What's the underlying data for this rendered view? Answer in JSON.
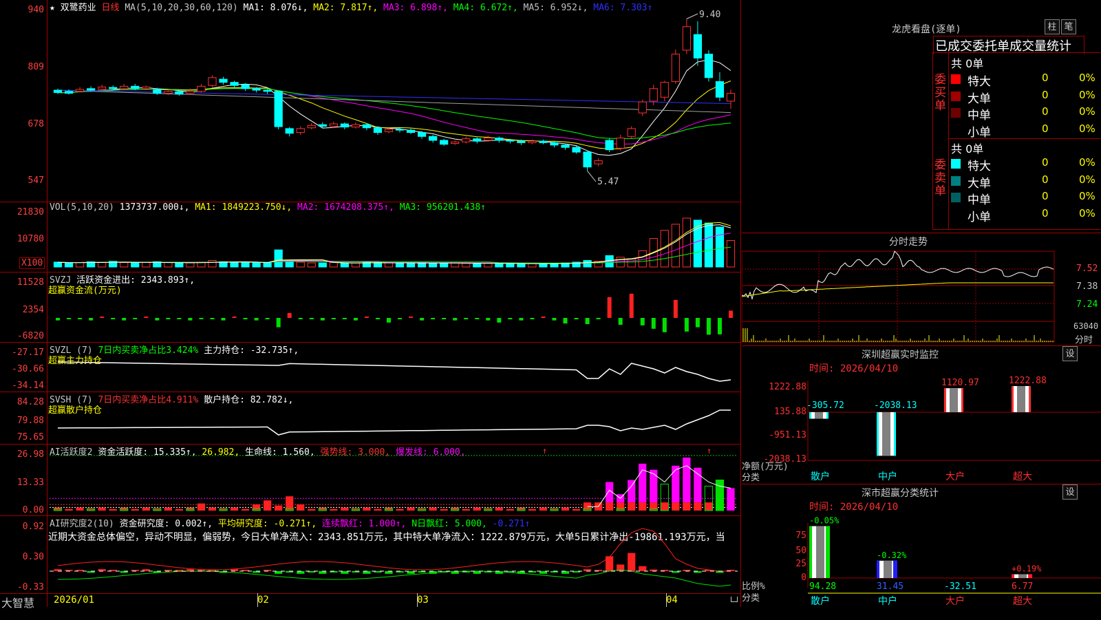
{
  "stock": {
    "star": "★",
    "name": "双鹭药业",
    "period": "日线",
    "ma_info": [
      {
        "text": "MA(5,10,20,30,60,120)",
        "color": "#c8c8c8"
      },
      {
        "text": "MA1: 8.076↓,",
        "color": "#ffffff"
      },
      {
        "text": "MA2: 7.817↑,",
        "color": "#ffff00"
      },
      {
        "text": "MA3: 6.898↑,",
        "color": "#ff00ff"
      },
      {
        "text": "MA4: 6.672↑,",
        "color": "#00ff00"
      },
      {
        "text": "MA5: 6.952↓,",
        "color": "#c0c0c0"
      },
      {
        "text": "MA6: 7.303↑",
        "color": "#3030ff"
      }
    ],
    "yticks": [
      "940",
      "809",
      "678",
      "547"
    ],
    "high_label": "9.40",
    "low_label": "5.47"
  },
  "vol": {
    "info": [
      {
        "text": "VOL(5,10,20)",
        "color": "#c8c8c8"
      },
      {
        "text": "1373737.000↓,",
        "color": "#ffffff"
      },
      {
        "text": "MA1: 1849223.750↓,",
        "color": "#ffff00"
      },
      {
        "text": "MA2: 1674208.375↑,",
        "color": "#ff00ff"
      },
      {
        "text": "MA3: 956201.438↑",
        "color": "#00ff00"
      }
    ],
    "yticks": [
      "21830",
      "10780"
    ],
    "unit": "X100"
  },
  "svzj": {
    "info": [
      {
        "text": "SVZJ",
        "color": "#c8c8c8"
      },
      {
        "text": "活跃资金进出: 2343.893↑,",
        "color": "#ffffff"
      }
    ],
    "subtitle": "超赢资金流(万元)",
    "yticks": [
      "11528",
      "2354",
      "-6820"
    ]
  },
  "svzl": {
    "info": [
      {
        "text": "SVZL (7)",
        "color": "#c8c8c8"
      },
      {
        "text": "7日内买卖净占比3.424%",
        "color": "#00ff00"
      },
      {
        "text": "主力持仓: -32.735↑,",
        "color": "#ffffff"
      }
    ],
    "subtitle": "超赢主力持仓",
    "yticks": [
      "-27.17",
      "-30.66",
      "-34.14"
    ]
  },
  "svsh": {
    "info": [
      {
        "text": "SVSH (7)",
        "color": "#c8c8c8"
      },
      {
        "text": "7日内买卖净占比4.911%",
        "color": "#ff3030"
      },
      {
        "text": "散户持仓: 82.782↓,",
        "color": "#ffffff"
      }
    ],
    "subtitle": "超赢散户持仓",
    "yticks": [
      "84.28",
      "79.88",
      "75.65"
    ]
  },
  "ai_active": {
    "info": [
      {
        "text": "AI活跃度2",
        "color": "#c8c8c8"
      },
      {
        "text": "资金活跃度: 15.335↑,",
        "color": "#ffffff"
      },
      {
        "text": "26.982,",
        "color": "#ffff00"
      },
      {
        "text": "生命线: 1.560,",
        "color": "#ffffff"
      },
      {
        "text": "强势线: 3.000,",
        "color": "#ff3030"
      },
      {
        "text": "爆发线: 6.000,",
        "color": "#ff00ff"
      }
    ],
    "yticks": [
      "26.98",
      "13.33",
      "0.00"
    ]
  },
  "ai_research": {
    "info": [
      {
        "text": "AI研究度2(10)",
        "color": "#c8c8c8"
      },
      {
        "text": "资金研究度: 0.002↑,",
        "color": "#ffffff"
      },
      {
        "text": "平均研究度: -0.271↑,",
        "color": "#ffff00"
      },
      {
        "text": "连续飘红: 1.000↑,",
        "color": "#ff00ff"
      },
      {
        "text": "N日飘红: 5.000,",
        "color": "#00ff00"
      },
      {
        "text": "-0.271↑",
        "color": "#3030ff"
      }
    ],
    "comment": "近期大资金总体偏空，异动不明显，偏弱势，今日大单净流入：2343.851万元，其中特大单净流入：1222.879万元，大单5日累计净出-19861.193万元，当",
    "yticks": [
      "0.92",
      "0.30",
      "-0.33"
    ]
  },
  "xaxis": {
    "brand": "大智慧",
    "labels": [
      "2026/01",
      "02",
      "03",
      "04"
    ]
  },
  "dragon_tiger": {
    "title": "龙虎看盘(逐单)",
    "btn_bar": "柱",
    "btn_pen": "笔",
    "tabs": [
      "已成交委托单成交量统计"
    ],
    "buy": {
      "label": "委买单",
      "total": "共 0单",
      "rows": [
        {
          "name": "特大",
          "value": "0",
          "pct": "0%",
          "color": "#ff0000"
        },
        {
          "name": "大单",
          "value": "0",
          "pct": "0%",
          "color": "#a00000"
        },
        {
          "name": "中单",
          "value": "0",
          "pct": "0%",
          "color": "#700000"
        },
        {
          "name": "小单",
          "value": "0",
          "pct": "0%",
          "color": ""
        }
      ]
    },
    "sell": {
      "label": "委卖单",
      "total": "共 0单",
      "rows": [
        {
          "name": "特大",
          "value": "0",
          "pct": "0%",
          "color": "#00ffff"
        },
        {
          "name": "大单",
          "value": "0",
          "pct": "0%",
          "color": "#008080"
        },
        {
          "name": "中单",
          "value": "0",
          "pct": "0%",
          "color": "#006060"
        },
        {
          "name": "小单",
          "value": "0",
          "pct": "0%",
          "color": ""
        }
      ]
    }
  },
  "intraday": {
    "title": "分时走势",
    "yticks": [
      "7.52",
      "7.38",
      "7.24"
    ],
    "vol_tick": "63040",
    "vol_unit": "分时"
  },
  "sz_monitor": {
    "title": "深圳超赢实时监控",
    "btn": "设",
    "time": "时间: 2026/04/10",
    "yticks": [
      "1222.88",
      "135.88",
      "-951.13",
      "-2038.13"
    ],
    "ylabel": "净额(万元)",
    "xlabel": "分类",
    "categories": [
      "散户",
      "中户",
      "大户",
      "超大"
    ],
    "values": [
      -305.72,
      -2038.13,
      1120.97,
      1222.88
    ],
    "value_labels": [
      "-305.72",
      "-2038.13",
      "1120.97",
      "1222.88"
    ]
  },
  "sz_class": {
    "title": "深市超赢分类统计",
    "btn": "设",
    "time": "时间: 2026/04/10",
    "yticks": [
      "75",
      "50",
      "25",
      "0"
    ],
    "ylabel": "比例%",
    "xlabel": "分类",
    "categories": [
      "散户",
      "中户",
      "大户",
      "超大"
    ],
    "values": [
      94.28,
      31.45,
      -32.51,
      6.77
    ],
    "top_labels": [
      "-0.05%",
      "-0.32%",
      "",
      "+0.19%"
    ],
    "bottom_labels": [
      "94.28",
      "31.45",
      "-32.51",
      "6.77"
    ]
  },
  "chart_data": {
    "type": "candlestick",
    "title": "双鹭药业 日线",
    "ylim": [
      5.0,
      9.6
    ],
    "ma_colors": [
      "#ffffff",
      "#ffff00",
      "#ff00ff",
      "#00ff00",
      "#a0a0a0",
      "#3030ff"
    ],
    "candles": [
      [
        7.58,
        7.52,
        7.62,
        7.48
      ],
      [
        7.55,
        7.5,
        7.6,
        7.47
      ],
      [
        7.55,
        7.6,
        7.66,
        7.52
      ],
      [
        7.62,
        7.58,
        7.68,
        7.55
      ],
      [
        7.6,
        7.66,
        7.72,
        7.56
      ],
      [
        7.65,
        7.62,
        7.7,
        7.58
      ],
      [
        7.62,
        7.68,
        7.74,
        7.6
      ],
      [
        7.68,
        7.62,
        7.74,
        7.58
      ],
      [
        7.62,
        7.66,
        7.7,
        7.58
      ],
      [
        7.6,
        7.5,
        7.64,
        7.46
      ],
      [
        7.5,
        7.55,
        7.6,
        7.46
      ],
      [
        7.54,
        7.48,
        7.58,
        7.44
      ],
      [
        7.5,
        7.55,
        7.62,
        7.46
      ],
      [
        7.55,
        7.68,
        7.74,
        7.52
      ],
      [
        7.7,
        7.9,
        7.96,
        7.66
      ],
      [
        7.86,
        7.78,
        7.92,
        7.72
      ],
      [
        7.78,
        7.7,
        7.82,
        7.62
      ],
      [
        7.72,
        7.62,
        7.76,
        7.56
      ],
      [
        7.62,
        7.58,
        7.66,
        7.52
      ],
      [
        7.58,
        7.55,
        7.62,
        7.48
      ],
      [
        7.55,
        6.65,
        7.0,
        6.58
      ],
      [
        6.6,
        6.48,
        6.64,
        6.4
      ],
      [
        6.5,
        6.6,
        6.66,
        6.44
      ],
      [
        6.62,
        6.68,
        6.74,
        6.58
      ],
      [
        6.7,
        6.66,
        6.76,
        6.6
      ],
      [
        6.66,
        6.72,
        6.78,
        6.62
      ],
      [
        6.72,
        6.64,
        6.76,
        6.58
      ],
      [
        6.64,
        6.7,
        6.76,
        6.6
      ],
      [
        6.7,
        6.62,
        6.74,
        6.56
      ],
      [
        6.62,
        6.5,
        6.66,
        6.44
      ],
      [
        6.52,
        6.58,
        6.62,
        6.48
      ],
      [
        6.58,
        6.56,
        6.64,
        6.5
      ],
      [
        6.56,
        6.5,
        6.6,
        6.46
      ],
      [
        6.5,
        6.4,
        6.54,
        6.34
      ],
      [
        6.4,
        6.3,
        6.44,
        6.24
      ],
      [
        6.3,
        6.2,
        6.34,
        6.16
      ],
      [
        6.22,
        6.26,
        6.3,
        6.18
      ],
      [
        6.26,
        6.34,
        6.4,
        6.22
      ],
      [
        6.34,
        6.28,
        6.38,
        6.22
      ],
      [
        6.3,
        6.36,
        6.42,
        6.26
      ],
      [
        6.36,
        6.3,
        6.4,
        6.24
      ],
      [
        6.3,
        6.28,
        6.34,
        6.22
      ],
      [
        6.28,
        6.24,
        6.32,
        6.18
      ],
      [
        6.24,
        6.28,
        6.32,
        6.2
      ],
      [
        6.28,
        6.24,
        6.32,
        6.2
      ],
      [
        6.24,
        6.18,
        6.28,
        6.12
      ],
      [
        6.18,
        6.12,
        6.22,
        6.06
      ],
      [
        6.12,
        6.0,
        6.16,
        5.96
      ],
      [
        6.0,
        5.62,
        6.04,
        5.52
      ],
      [
        5.7,
        5.78,
        5.84,
        5.64
      ],
      [
        6.3,
        6.06,
        6.36,
        6.0
      ],
      [
        6.1,
        6.36,
        6.44,
        6.04
      ],
      [
        6.4,
        6.6,
        6.66,
        6.34
      ],
      [
        7.0,
        7.28,
        7.34,
        6.92
      ],
      [
        7.3,
        7.62,
        7.72,
        7.2
      ],
      [
        7.4,
        7.78,
        7.82,
        7.3
      ],
      [
        7.8,
        8.5,
        8.62,
        7.74
      ],
      [
        8.6,
        9.2,
        9.4,
        8.5
      ],
      [
        9.0,
        8.4,
        9.34,
        8.2
      ],
      [
        8.5,
        7.9,
        8.6,
        7.8
      ],
      [
        7.8,
        7.4,
        8.04,
        7.3
      ],
      [
        7.3,
        7.5,
        7.6,
        7.1
      ]
    ],
    "volumes": [
      1.2,
      1.0,
      1.1,
      1.3,
      1.2,
      1.4,
      1.1,
      1.0,
      1.2,
      1.3,
      1.1,
      1.0,
      1.0,
      1.2,
      1.6,
      1.3,
      1.2,
      1.1,
      1.0,
      1.0,
      4.2,
      1.5,
      1.2,
      1.0,
      1.0,
      1.1,
      1.0,
      1.0,
      1.2,
      1.1,
      1.0,
      1.0,
      1.0,
      1.1,
      1.0,
      1.0,
      1.0,
      0.9,
      1.0,
      0.9,
      0.9,
      0.9,
      0.8,
      0.9,
      0.9,
      0.9,
      1.0,
      1.2,
      1.6,
      1.4,
      2.8,
      2.4,
      2.0,
      4.0,
      7.0,
      9.0,
      10.5,
      12.0,
      11.5,
      10.8,
      9.8,
      6.5
    ]
  }
}
